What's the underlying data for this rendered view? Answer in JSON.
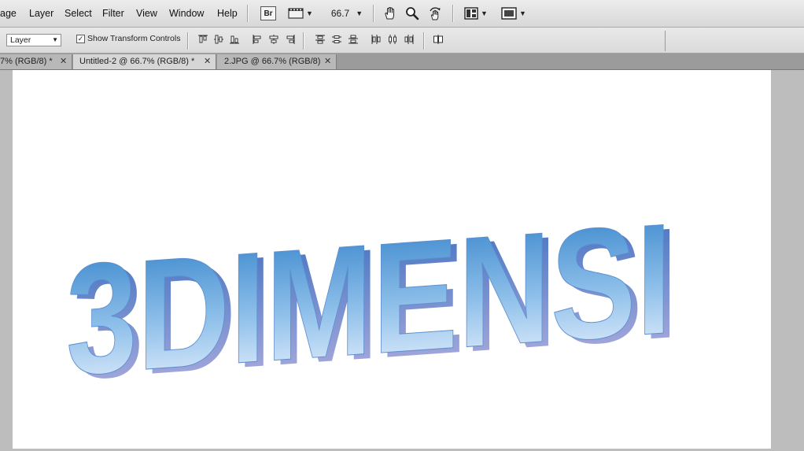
{
  "menu": {
    "items": [
      "age",
      "Layer",
      "Select",
      "Filter",
      "View",
      "Window",
      "Help"
    ]
  },
  "toolbar": {
    "bridge_label": "Br",
    "zoom_value": "66.7"
  },
  "options": {
    "layer_select": "Layer",
    "show_transform_checked": "✓",
    "show_transform_label": "Show Transform Controls"
  },
  "tabs": [
    {
      "label": "7% (RGB/8) *",
      "active": false
    },
    {
      "label": "Untitled-2 @ 66.7% (RGB/8) *",
      "active": true
    },
    {
      "label": "2.JPG @ 66.7% (RGB/8)",
      "active": false
    }
  ],
  "canvas": {
    "text": "3DIMENSI",
    "colors": {
      "top": "#2f7fc8",
      "bottom": "#f2f6ff",
      "side": "#8a88c9"
    }
  }
}
